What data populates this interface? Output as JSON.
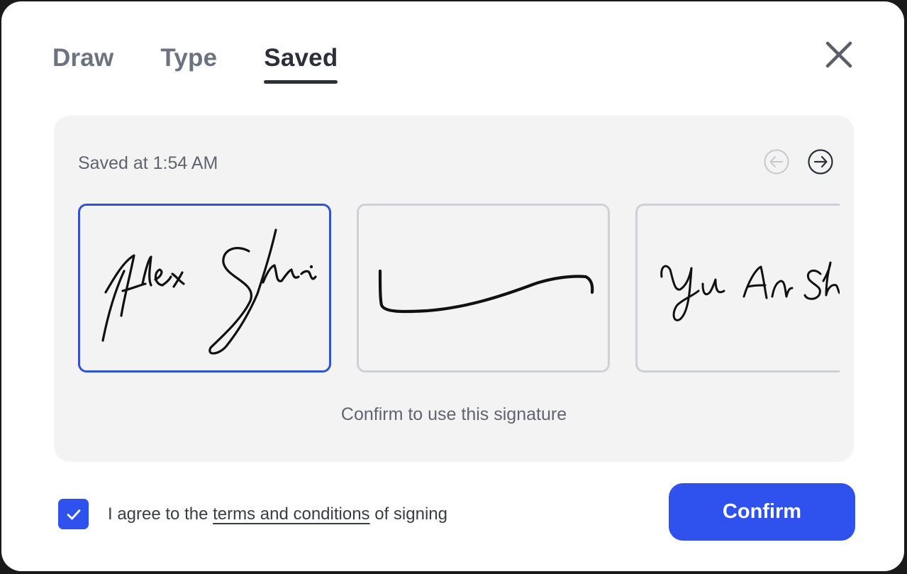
{
  "tabs": [
    {
      "label": "Draw",
      "active": false
    },
    {
      "label": "Type",
      "active": false
    },
    {
      "label": "Saved",
      "active": true
    }
  ],
  "close_icon": "close-x-icon",
  "panel": {
    "saved_at": "Saved at 1:54 AM",
    "prev_icon": "arrow-left-circle-icon",
    "next_icon": "arrow-right-circle-icon",
    "signatures": [
      {
        "name": "Alex Shi handwritten signature",
        "selected": true
      },
      {
        "name": "Line signature",
        "selected": false
      },
      {
        "name": "Yu An Shi handwritten signature",
        "selected": false
      }
    ],
    "hint": "Confirm to use this signature"
  },
  "agreement": {
    "checked": true,
    "prefix": "I agree to the ",
    "link": "terms and conditions",
    "suffix": " of signing"
  },
  "confirm_label": "Confirm",
  "colors": {
    "accent": "#2f52ee",
    "selected_border": "#2f52d6",
    "text_dark": "#2b2f3a",
    "text_muted": "#6b7280",
    "panel_bg": "#f3f3f4"
  }
}
